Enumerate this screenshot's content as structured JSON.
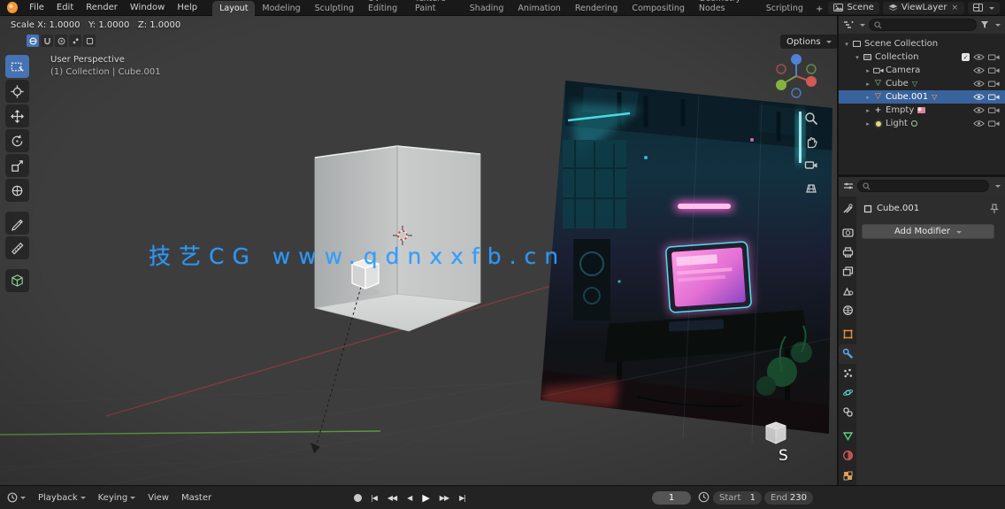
{
  "topbar": {
    "menus": [
      "File",
      "Edit",
      "Render",
      "Window",
      "Help"
    ],
    "tabs": [
      "Layout",
      "Modeling",
      "Sculpting",
      "UV Editing",
      "Texture Paint",
      "Shading",
      "Animation",
      "Rendering",
      "Compositing",
      "Geometry Nodes",
      "Scripting"
    ],
    "add_tab": "+",
    "scene": "Scene",
    "view_layer": "ViewLayer"
  },
  "viewport": {
    "operator": "Scale X: 1.0000   Y: 1.0000   Z: 1.0000",
    "view_label": "User Perspective",
    "context_label": "(1) Collection | Cube.001",
    "options_button": "Options",
    "watermark": "技艺CG www.qdnxxfb.cn",
    "key_hint": "S"
  },
  "outliner": {
    "rows": [
      {
        "label": "Scene Collection"
      },
      {
        "label": "Collection"
      },
      {
        "label": "Camera"
      },
      {
        "label": "Cube"
      },
      {
        "label": "Cube.001",
        "selected": true
      },
      {
        "label": "Empty"
      },
      {
        "label": "Light"
      }
    ]
  },
  "properties": {
    "object_name": "Cube.001",
    "add_modifier": "Add Modifier"
  },
  "timeline": {
    "menus": [
      "Playback",
      "Keying",
      "View",
      "Master"
    ],
    "transport": [
      "|◀",
      "◀◀",
      "◀",
      "▶",
      "▶▶",
      "▶|"
    ],
    "current_frame": "1",
    "start_label": "Start",
    "start_value": "1",
    "end_label": "End",
    "end_value": "230"
  },
  "colors": {
    "accent": "#4772b3",
    "selection": "#38639c",
    "axis_x": "#8a3b42",
    "axis_y": "#5f9e3f",
    "watermark": "#2e9bff"
  }
}
